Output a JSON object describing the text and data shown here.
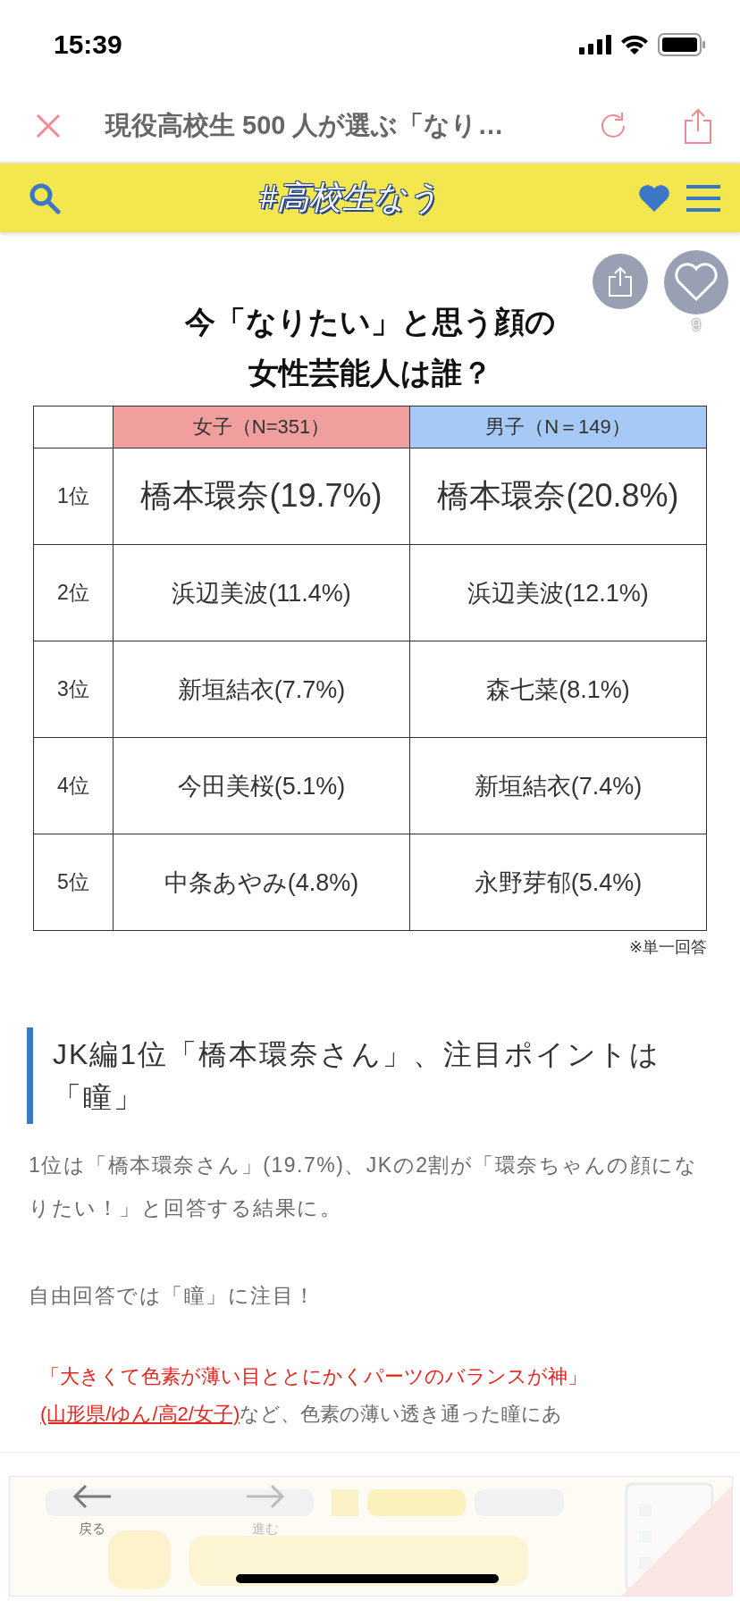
{
  "status_bar": {
    "time": "15:39"
  },
  "browser_bar": {
    "title": "現役高校生 500 人が選ぶ「なり…"
  },
  "site_header": {
    "logo": "#高校生なう"
  },
  "float_actions": {
    "like_count": "9"
  },
  "ranking_image": {
    "title_lines": [
      "今「なりたい」と思う顔の",
      "女性芸能人は誰？"
    ],
    "columns": [
      {
        "label": "女子（N=351）",
        "color": "#f19e9e"
      },
      {
        "label": "男子（N＝149）",
        "color": "#a6c9f5"
      }
    ],
    "rows": [
      {
        "rank": "1位",
        "emphasized": true,
        "cells": [
          "橋本環奈(19.7%)",
          "橋本環奈(20.8%)"
        ]
      },
      {
        "rank": "2位",
        "emphasized": false,
        "cells": [
          "浜辺美波(11.4%)",
          "浜辺美波(12.1%)"
        ]
      },
      {
        "rank": "3位",
        "emphasized": false,
        "cells": [
          "新垣結衣(7.7%)",
          "森七菜(8.1%)"
        ]
      },
      {
        "rank": "4位",
        "emphasized": false,
        "cells": [
          "今田美桜(5.1%)",
          "新垣結衣(7.4%)"
        ]
      },
      {
        "rank": "5位",
        "emphasized": false,
        "cells": [
          "中条あやみ(4.8%)",
          "永野芽郁(5.4%)"
        ]
      }
    ],
    "note": "※単一回答"
  },
  "article": {
    "heading": "JK編1位「橋本環奈さん」、注目ポイントは「瞳」",
    "paragraphs": [
      "1位は「橋本環奈さん」(19.7%)、JKの2割が「環奈ちゃんの顔になりたい！」と回答する結果に。",
      "自由回答では「瞳」に注目！"
    ],
    "quote": "「大きくて色素が薄い目ととにかくパーツのバランスが神」",
    "quote_line": {
      "source": "(山形県/ゆん/高2/女子)",
      "rest": "など、色素の薄い透き通った瞳にあ"
    }
  },
  "bottom_toolbar": {
    "back": {
      "label": "戻る",
      "disabled": false
    },
    "forward": {
      "label": "進む",
      "disabled": true
    }
  }
}
